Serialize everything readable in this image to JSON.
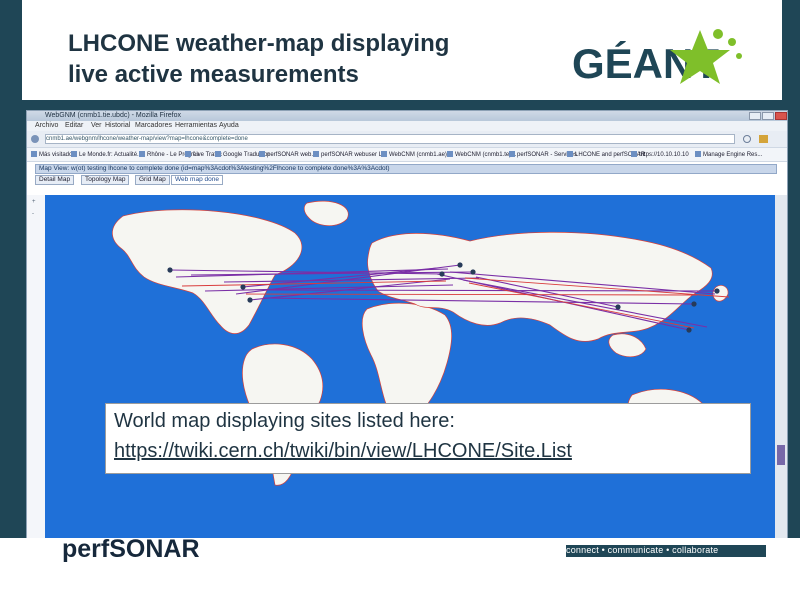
{
  "slide": {
    "title_line1": "LHCONE weather-map displaying",
    "title_line2": "live active measurements",
    "logo_text": "GÉANT",
    "logo_color": "#7fbf2a",
    "callout_text": "World map displaying sites listed here:",
    "callout_link": "https://twiki.cern.ch/twiki/bin/view/LHCONE/Site.List",
    "perfsonar_text": "perfSONAR",
    "tagline": "connect • communicate • collaborate"
  },
  "browser": {
    "title_text": "WebGNM (cnmb1.tie.ubdc) - Mozilla Firefox",
    "menu": [
      "Archivo",
      "Editar",
      "Ver",
      "Historial",
      "Marcadores",
      "Herramientas",
      "Ayuda"
    ],
    "url_text": "cnmb1.ae/webgnm/lhcone/weather-map/view?map=lhcone&complete=done",
    "bookmarks": [
      "Más visitados",
      "Le Monde.fr: Actualité...",
      "Rhône - Le Progrès",
      "Live Traffic",
      "Google Traductor",
      "perfSONAR web...",
      "perfSONAR webuser L...",
      "WebCNM (cnmb1.ae)...",
      "WebCNM (cnmb1.te)...",
      "perfSONAR - Services",
      "LHCONE and perfSONAR",
      "https://10.10.10.10",
      "Manage Engine Res..."
    ],
    "mapview_title": "Map View: w(ot) testing lhcone to complete done (id=map%3Acdot%3Atesting%2Flhcone to complete done%3A%3Acdot)",
    "tabs": [
      "Detail Map",
      "Topology Map",
      "Grid Map",
      "Web map done"
    ],
    "active_tab_index": 3
  },
  "colors": {
    "page_bg": "#1f4656",
    "ocean": "#1f70d8",
    "land": "#f6f6f2",
    "borders": "#d6423b",
    "links": "#7a2fa6",
    "links_alt": "#d93c3c",
    "accent": "#7768a8"
  }
}
